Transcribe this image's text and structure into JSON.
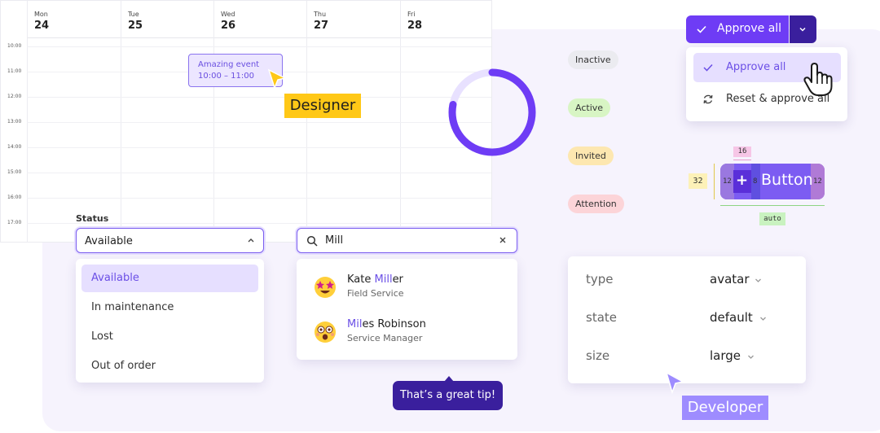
{
  "calendar": {
    "days": [
      {
        "dow": "Mon",
        "num": "24"
      },
      {
        "dow": "Tue",
        "num": "25"
      },
      {
        "dow": "Wed",
        "num": "26"
      },
      {
        "dow": "Thu",
        "num": "27"
      },
      {
        "dow": "Fri",
        "num": "28"
      }
    ],
    "hours": [
      "10:00",
      "11:00",
      "12:00",
      "13:00",
      "14:00",
      "15:00",
      "16:00",
      "17:00"
    ],
    "event": {
      "title": "Amazing event",
      "time": "10:00 – 11:00"
    }
  },
  "designer_tag": "Designer",
  "developer_tag": "Developer",
  "status": {
    "label": "Status",
    "value": "Available",
    "options": [
      "Available",
      "In maintenance",
      "Lost",
      "Out of order"
    ]
  },
  "search": {
    "value": "Mill",
    "results": [
      {
        "name_highlight": "Mill",
        "name_rest": "er",
        "name_prefix": "Kate ",
        "role": "Field Service"
      },
      {
        "name_highlight": "Mil",
        "name_rest": "es Robinson",
        "name_prefix": "",
        "role": "Service Manager"
      }
    ]
  },
  "tip": "That’s a great tip!",
  "ring": {
    "progress_fraction": 0.78,
    "color": "#6e3cf5",
    "track_color": "#e8e1ff"
  },
  "badges": [
    {
      "label": "Inactive",
      "color": "#ebebf0"
    },
    {
      "label": "Active",
      "color": "#d8f5c4"
    },
    {
      "label": "Invited",
      "color": "#fde7b0"
    },
    {
      "label": "Attention",
      "color": "#fcd4d8"
    }
  ],
  "approve": {
    "button_label": "Approve all",
    "menu": [
      "Approve all",
      "Reset & approve all"
    ],
    "color": "#6e3cf5"
  },
  "spec": {
    "label": "Button",
    "icon": "+",
    "height": "32",
    "icon_size": "16",
    "padding": "12",
    "gap": "8",
    "width": "auto"
  },
  "props": [
    {
      "key": "type",
      "value": "avatar"
    },
    {
      "key": "state",
      "value": "default"
    },
    {
      "key": "size",
      "value": "large"
    }
  ]
}
